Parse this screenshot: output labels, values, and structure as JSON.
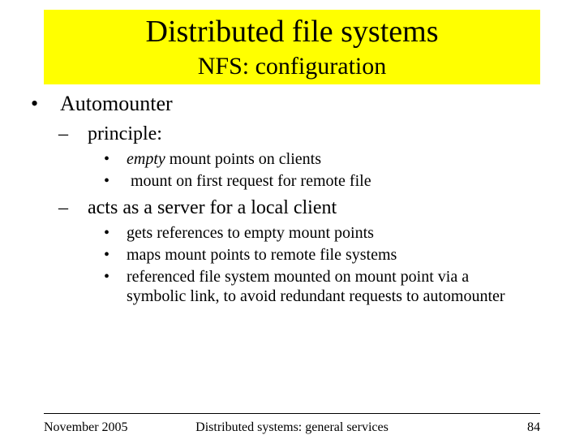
{
  "header": {
    "title": "Distributed file systems",
    "subtitle": "NFS: configuration"
  },
  "body": {
    "l1": {
      "bullet": "•",
      "text": "Automounter"
    },
    "l2a": {
      "dash": "–",
      "text": "principle:"
    },
    "l3a": {
      "dot": "•",
      "em": "empty",
      "text": " mount points on clients"
    },
    "l3b": {
      "dot": "•",
      "text": " mount on first request for remote file"
    },
    "l2b": {
      "dash": "–",
      "text": "acts as a server for a local client"
    },
    "l3c": {
      "dot": "•",
      "text": "gets references to empty mount points"
    },
    "l3d": {
      "dot": "•",
      "text": "maps mount points to remote file systems"
    },
    "l3e": {
      "dot": "•",
      "text": "referenced file system mounted on mount point via a symbolic link, to avoid redundant requests to automounter"
    }
  },
  "footer": {
    "date": "November 2005",
    "center": "Distributed systems: general services",
    "page": "84"
  }
}
